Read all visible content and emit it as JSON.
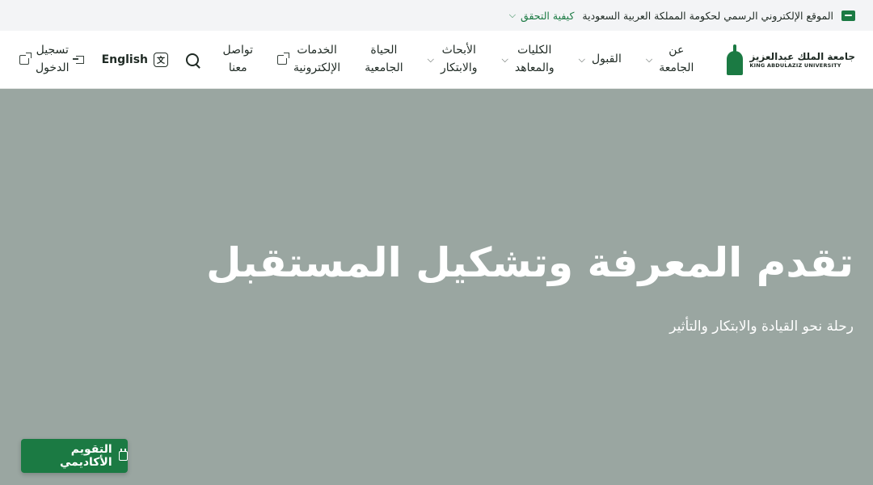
{
  "gov_bar": {
    "text": "الموقع الإلكتروني الرسمي لحكومة المملكة العربية السعودية",
    "verify_label": "كيفية التحقق"
  },
  "logo": {
    "arabic": "جامعة الملك عبدالعزيز",
    "english": "KING ABDULAZIZ UNIVERSITY"
  },
  "menu": [
    {
      "label": "عن\nالجامعة",
      "icon": "chevron-down-icon"
    },
    {
      "label": "القبول",
      "icon": "chevron-down-icon"
    },
    {
      "label": "الكليات\nوالمعاهد",
      "icon": "chevron-down-icon"
    },
    {
      "label": "الأبحاث\nوالابتكار",
      "icon": "chevron-down-icon"
    },
    {
      "label": "الحياة\nالجامعية",
      "icon": ""
    },
    {
      "label": "الخدمات\nالإلكترونية",
      "icon": "external-link-icon"
    },
    {
      "label": "تواصل\nمعنا",
      "icon": ""
    }
  ],
  "tools": {
    "language": "English",
    "login": "تسجيل\nالدخول"
  },
  "hero": {
    "title": "تقدم المعرفة وتشكيل المستقبل",
    "subtitle": "رحلة نحو القيادة والابتكار والتأثير"
  },
  "calendar_button": "التقويم الأكاديمي",
  "colors": {
    "brand_green": "#1b7a43",
    "hero_bg": "#9aa6a1"
  }
}
